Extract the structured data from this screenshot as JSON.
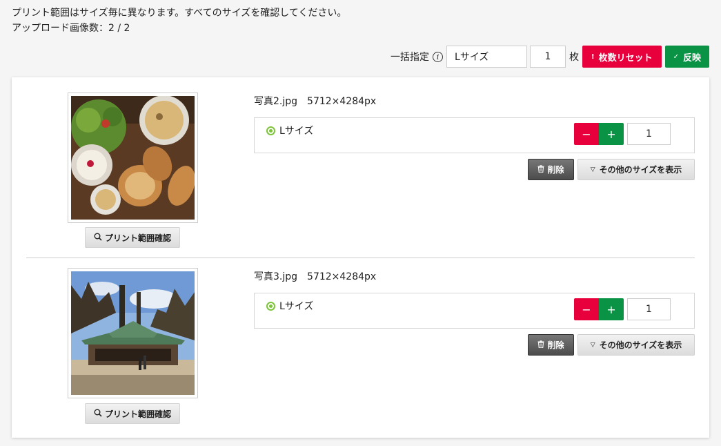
{
  "notice": {
    "line1": "プリント範囲はサイズ毎に異なります。すべてのサイズを確認してください。",
    "line2": "アップロード画像数：2 / 2"
  },
  "bulk": {
    "label": "一括指定",
    "info_icon": "info-icon",
    "size_value": "Lサイズ",
    "qty_value": "1",
    "unit": "枚",
    "reset_label": "枚数リセット",
    "reset_icon": "!",
    "apply_label": "反映",
    "apply_icon": "✓"
  },
  "items": [
    {
      "filename": "写真2.jpg",
      "dimensions": "5712×4284px",
      "size_name": "Lサイズ",
      "minus": "−",
      "plus": "+",
      "qty": "1",
      "preview_label": "プリント範囲確認",
      "delete_label": "削除",
      "more_label": "その他のサイズを表示"
    },
    {
      "filename": "写真3.jpg",
      "dimensions": "5712×4284px",
      "size_name": "Lサイズ",
      "minus": "−",
      "plus": "+",
      "qty": "1",
      "preview_label": "プリント範囲確認",
      "delete_label": "削除",
      "more_label": "その他のサイズを表示"
    }
  ],
  "colors": {
    "red": "#e8003d",
    "green": "#0a9245",
    "target": "#7dc43a"
  }
}
